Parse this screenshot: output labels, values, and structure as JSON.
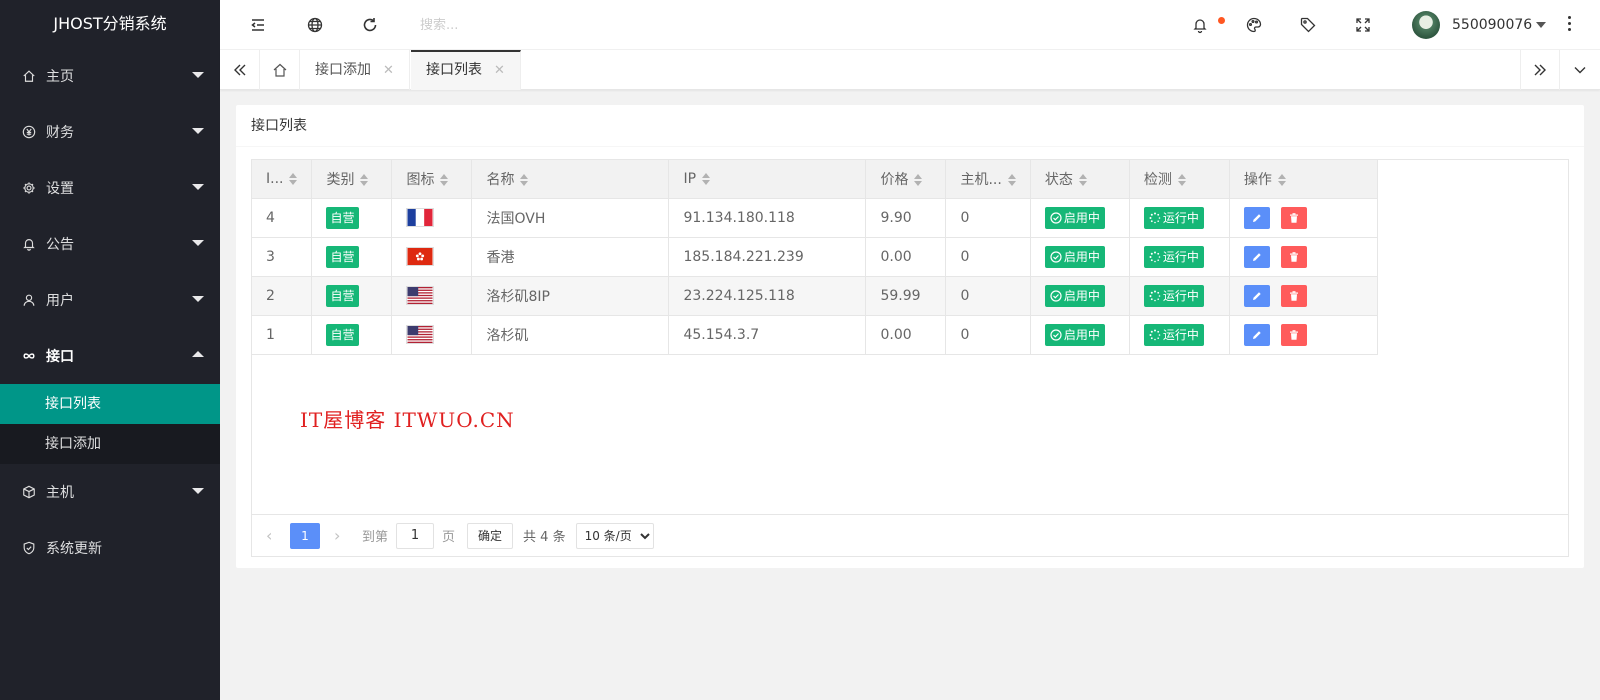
{
  "app_title": "JHOST分销系统",
  "sidebar": {
    "items": [
      {
        "label": "主页",
        "icon": "home-icon"
      },
      {
        "label": "财务",
        "icon": "yen-icon"
      },
      {
        "label": "设置",
        "icon": "gear-icon"
      },
      {
        "label": "公告",
        "icon": "bell-icon"
      },
      {
        "label": "用户",
        "icon": "user-icon"
      },
      {
        "label": "接口",
        "icon": "infinity-icon"
      },
      {
        "label": "主机",
        "icon": "cube-icon"
      },
      {
        "label": "系统更新",
        "icon": "shield-check-icon"
      }
    ],
    "sub_items": [
      {
        "label": "接口列表",
        "active": true
      },
      {
        "label": "接口添加",
        "active": false
      }
    ]
  },
  "header": {
    "search_placeholder": "搜索...",
    "username": "550090076",
    "notification_dot_color": "#ff5722"
  },
  "tabs": [
    {
      "label": "接口添加"
    },
    {
      "label": "接口列表"
    }
  ],
  "card": {
    "title": "接口列表"
  },
  "table": {
    "headers": [
      "I...",
      "类别",
      "图标",
      "名称",
      "IP",
      "价格",
      "主机...",
      "状态",
      "检测",
      "操作"
    ],
    "rows": [
      {
        "id": "4",
        "category": "自营",
        "flag": "france",
        "name": "法国OVH",
        "ip": "91.134.180.118",
        "price": "9.90",
        "hosts": "0",
        "status": "启用中",
        "check": "运行中"
      },
      {
        "id": "3",
        "category": "自营",
        "flag": "hongkong",
        "name": "香港",
        "ip": "185.184.221.239",
        "price": "0.00",
        "hosts": "0",
        "status": "启用中",
        "check": "运行中"
      },
      {
        "id": "2",
        "category": "自营",
        "flag": "usa",
        "name": "洛杉矶8IP",
        "ip": "23.224.125.118",
        "price": "59.99",
        "hosts": "0",
        "status": "启用中",
        "check": "运行中"
      },
      {
        "id": "1",
        "category": "自营",
        "flag": "usa",
        "name": "洛杉矶",
        "ip": "45.154.3.7",
        "price": "0.00",
        "hosts": "0",
        "status": "启用中",
        "check": "运行中"
      }
    ]
  },
  "watermark": "IT屋博客 ITWUO.CN",
  "pager": {
    "current_page": "1",
    "goto_label": "到第",
    "goto_value": "1",
    "page_unit": "页",
    "confirm_label": "确定",
    "total_label": "共 4 条",
    "page_size_option": "10 条/页"
  },
  "colors": {
    "sidebar_bg": "#20222a",
    "sidebar_active": "#009688",
    "badge_green": "#16b777",
    "edit_blue": "#5b8ff9",
    "delete_red": "#ff5b5b"
  }
}
